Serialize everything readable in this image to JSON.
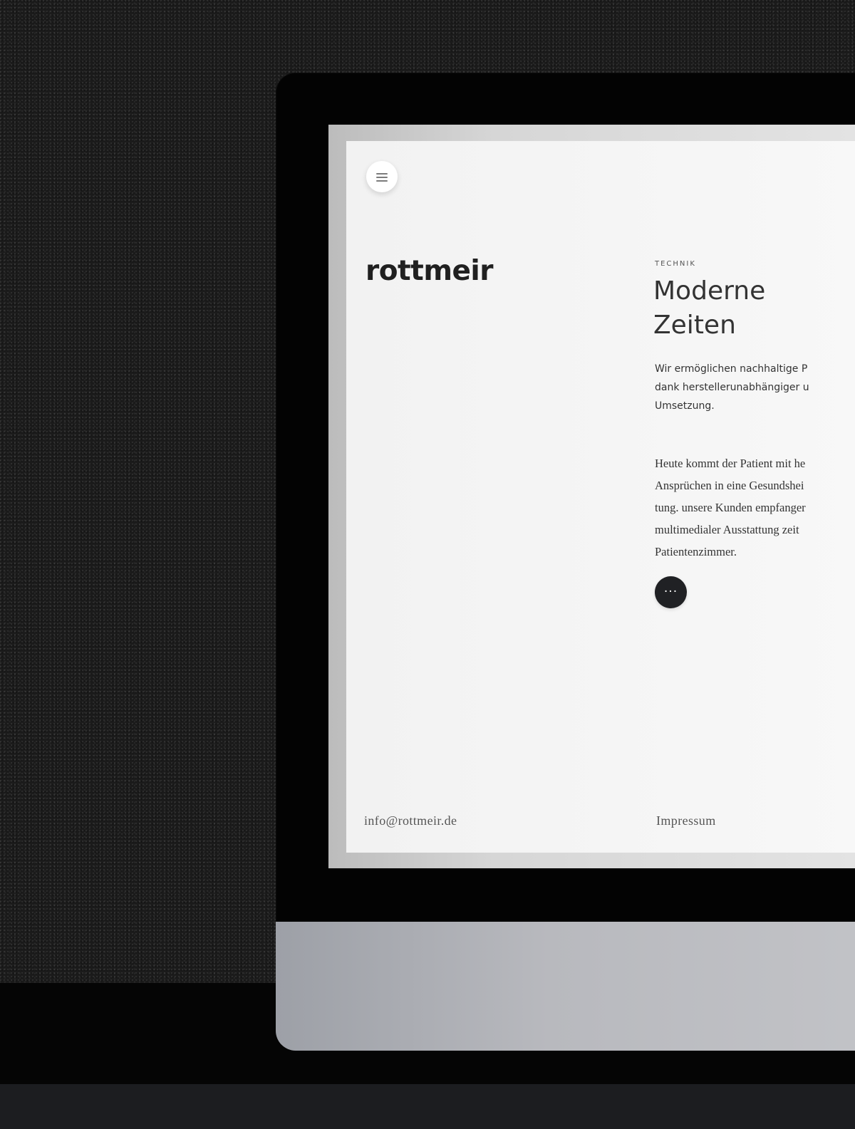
{
  "brand": {
    "logo": "rottmeir"
  },
  "navigation": {
    "menu_icon": "hamburger-icon",
    "faint_lines": [
      "",
      ""
    ]
  },
  "hero": {
    "eyebrow": "TECHNIK",
    "title": "Moderne\nZeiten",
    "lead": "Wir ermöglichen nachhaltige P\ndank herstellerunabhängiger u\nUmsetzung.",
    "body": "Heute kommt der Patient mit he\nAnsprüchen in eine Gesundshei\ntung. unsere Kunden empfanger\nmultimedialer Ausstattung zeit\nPatientenzimmer.",
    "more_label": "···"
  },
  "footer": {
    "email": "info@rottmeir.de",
    "impressum": "Impressum"
  },
  "colors": {
    "background": "#1b1b1b",
    "screen": "#f5f5f5",
    "text": "#333333",
    "button_dark": "#202124"
  }
}
